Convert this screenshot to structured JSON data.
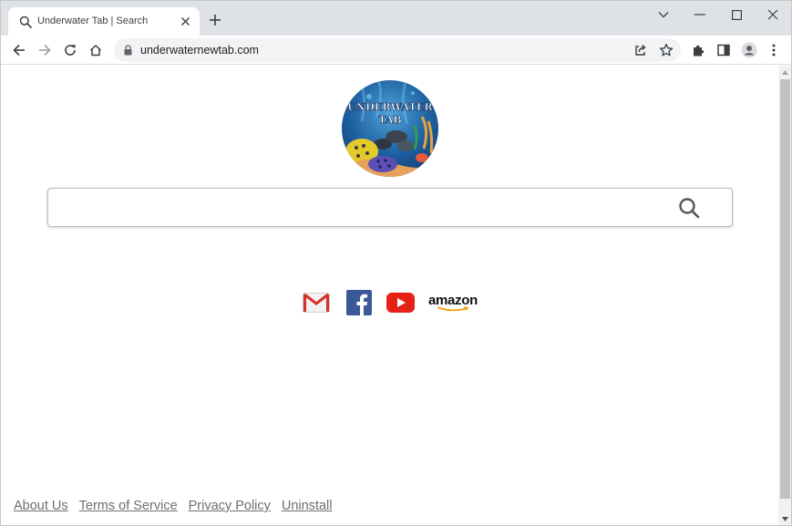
{
  "tab": {
    "title": "Underwater Tab | Search",
    "favicon": "search-icon"
  },
  "window_controls": [
    "chevron-down-icon",
    "minimize-icon",
    "maximize-icon",
    "close-icon"
  ],
  "toolbar": {
    "url": "underwaternewtab.com",
    "icons": [
      "back-arrow-icon",
      "forward-arrow-icon",
      "reload-icon",
      "home-icon",
      "lock-icon",
      "share-icon",
      "star-icon",
      "puzzle-icon",
      "side-panel-icon",
      "profile-icon",
      "kebab-menu-icon"
    ]
  },
  "logo": {
    "line1": "UNDERWATER",
    "line2": "TAB"
  },
  "search": {
    "value": "",
    "placeholder": ""
  },
  "quick_links": [
    {
      "name": "gmail",
      "icon": "gmail-icon"
    },
    {
      "name": "facebook",
      "icon": "facebook-icon"
    },
    {
      "name": "youtube",
      "icon": "youtube-icon"
    },
    {
      "name": "amazon",
      "icon": "amazon-icon",
      "text": "amazon"
    }
  ],
  "footer": {
    "links": [
      "About Us",
      "Terms of Service",
      "Privacy Policy",
      "Uninstall"
    ]
  },
  "colors": {
    "tabstrip": "#dee1e6",
    "omnibox": "#f1f3f4",
    "footer_link": "#6e6e6e",
    "youtube_red": "#e62117",
    "facebook_blue": "#3b5998",
    "amazon_orange": "#f39c12"
  }
}
